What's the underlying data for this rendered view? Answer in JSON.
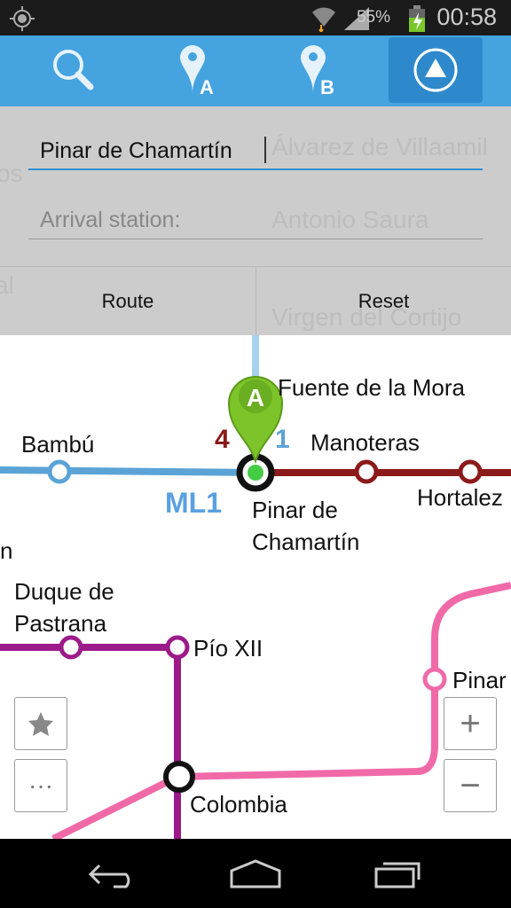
{
  "status_bar": {
    "battery": "55%",
    "time": "00:58",
    "icons": [
      "gps-icon",
      "wifi-icon",
      "signal-icon",
      "battery-charging-icon"
    ]
  },
  "toolbar": {
    "items": [
      {
        "name": "search-icon"
      },
      {
        "name": "pin-a-icon",
        "letter": "A"
      },
      {
        "name": "pin-b-icon",
        "letter": "B"
      },
      {
        "name": "navigate-up-icon",
        "selected": true
      }
    ]
  },
  "panel": {
    "departure_value": "Pinar de  Chamartín",
    "arrival_placeholder": "Arrival station:",
    "route_label": "Route",
    "reset_label": "Reset",
    "ghost_labels": [
      "Álvarez de Villaamil",
      "Antonio Saura",
      "Virgen del Cortijo",
      "os",
      "al"
    ]
  },
  "map": {
    "stations": [
      "Fuente de la Mora",
      "Bambú",
      "Manoteras",
      "Pinar de",
      "Chamartín",
      "Hortalez",
      "Duque de",
      "Pastrana",
      "Pío XII",
      "Pinar",
      "Colombia",
      "n"
    ],
    "line_labels": {
      "l4": "4",
      "l1": "1",
      "ml1": "ML1"
    },
    "pin_letter": "A",
    "colors": {
      "line1": "#5ba3d6",
      "line4": "#8b1a1a",
      "line9": "#9c1a8a",
      "line8": "#f06aa8",
      "ml1": "#5aa0e0",
      "pin": "#7dc42a"
    }
  },
  "controls": {
    "favorite": "star-icon",
    "more": "···",
    "zoom_in": "+",
    "zoom_out": "−"
  }
}
